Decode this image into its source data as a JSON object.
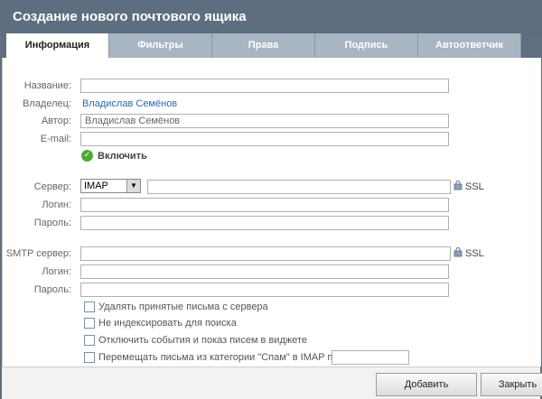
{
  "window": {
    "title": "Создание нового почтового ящика"
  },
  "tabs": [
    {
      "label": "Информация"
    },
    {
      "label": "Фильтры"
    },
    {
      "label": "Права"
    },
    {
      "label": "Подпись"
    },
    {
      "label": "Автоответчик"
    }
  ],
  "form": {
    "name_label": "Название:",
    "name_value": "",
    "owner_label": "Владелец:",
    "owner_value": "Владислав Семёнов",
    "author_label": "Автор:",
    "author_value": "Владислав Семёнов",
    "email_label": "E-mail:",
    "email_value": "",
    "enable_label": "Включить",
    "server_label": "Сервер:",
    "server_protocol": "IMAP",
    "server_value": "",
    "ssl_label": "SSL",
    "login_label": "Логин:",
    "login_value": "",
    "password_label": "Пароль:",
    "password_value": "",
    "smtp_label": "SMTP сервер:",
    "smtp_value": "",
    "smtp_ssl_label": "SSL",
    "smtp_login_label": "Логин:",
    "smtp_login_value": "",
    "smtp_password_label": "Пароль:",
    "smtp_password_value": ""
  },
  "options": [
    {
      "label": "Удалять принятые письма с сервера"
    },
    {
      "label": "Не индексировать для поиска"
    },
    {
      "label": "Отключить события и показ писем в виджете"
    },
    {
      "label": "Перемещать письма из категории \"Спам\" в IMAP папку:"
    }
  ],
  "footer": {
    "add_label": "Добавить",
    "close_label": "Закрыть"
  }
}
